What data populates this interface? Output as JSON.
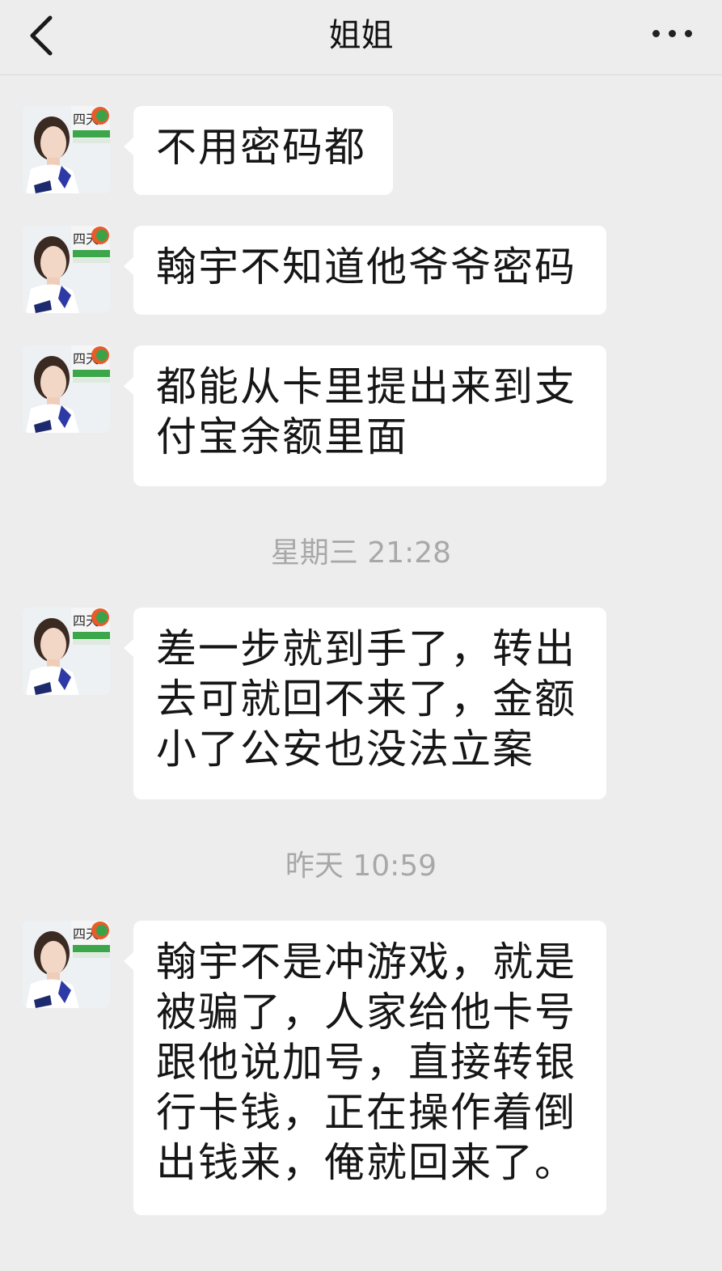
{
  "header": {
    "title": "姐姐",
    "back_icon": "chevron-left-icon",
    "more_icon": "more-dots-icon"
  },
  "avatar": {
    "description": "contact-avatar-photo",
    "badge_text": "四天"
  },
  "messages": [
    {
      "text": "不用密码都"
    },
    {
      "text": "翰宇不知道他爷爷密码"
    },
    {
      "text": "都能从卡里提出来到支付宝余额里面"
    },
    {
      "text": "差一步就到手了，转出去可就回不来了，金额小了公安也没法立案"
    },
    {
      "text": "翰宇不是冲游戏，就是被骗了，人家给他卡号跟他说加号，直接转银行卡钱，正在操作着倒出钱来，俺就回来了。"
    }
  ],
  "timestamps": {
    "first": "星期三 21:28",
    "second": "昨天 10:59"
  },
  "colors": {
    "background": "#ededed",
    "bubble": "#ffffff",
    "timestamp": "#a8a8a8"
  }
}
